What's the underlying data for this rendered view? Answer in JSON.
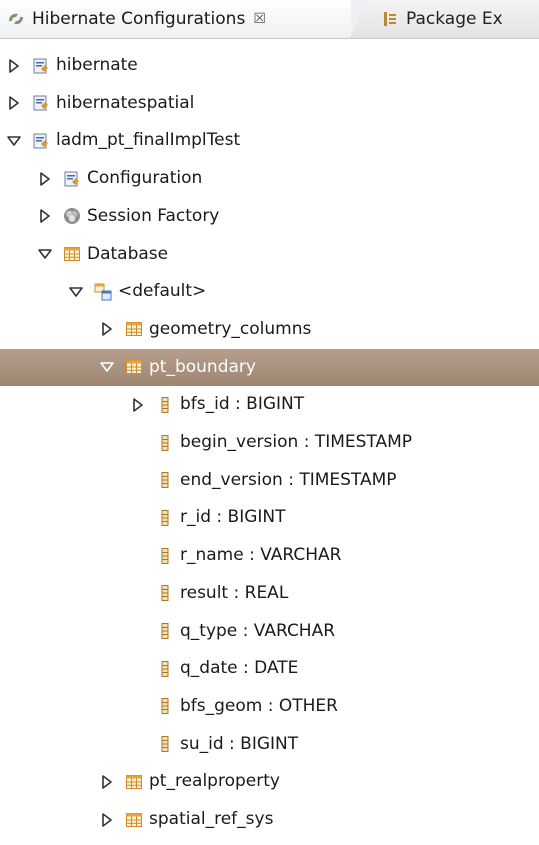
{
  "tabs": [
    {
      "label": "Hibernate Configurations",
      "close": "☒",
      "icon": "hibernate-config-icon",
      "active": true
    },
    {
      "label": "Package Ex",
      "icon": "package-explorer-icon",
      "active": false
    }
  ],
  "tree": {
    "rows": [
      {
        "label": "hibernate",
        "depth": 0,
        "twisty": "collapsed",
        "icon": "config-icon",
        "selected": false
      },
      {
        "label": "hibernatespatial",
        "depth": 0,
        "twisty": "collapsed",
        "icon": "config-icon",
        "selected": false
      },
      {
        "label": "ladm_pt_finalImplTest",
        "depth": 0,
        "twisty": "expanded",
        "icon": "config-icon",
        "selected": false
      },
      {
        "label": "Configuration",
        "depth": 1,
        "twisty": "collapsed",
        "icon": "config-icon",
        "selected": false
      },
      {
        "label": "Session Factory",
        "depth": 1,
        "twisty": "collapsed",
        "icon": "session-factory-icon",
        "selected": false
      },
      {
        "label": "Database",
        "depth": 1,
        "twisty": "expanded",
        "icon": "table-icon",
        "selected": false
      },
      {
        "label": "<default>",
        "depth": 2,
        "twisty": "expanded",
        "icon": "schema-icon",
        "selected": false
      },
      {
        "label": "geometry_columns",
        "depth": 3,
        "twisty": "collapsed",
        "icon": "table-icon",
        "selected": false
      },
      {
        "label": "pt_boundary",
        "depth": 3,
        "twisty": "expanded",
        "icon": "table-icon",
        "selected": true
      },
      {
        "label": "bfs_id : BIGINT",
        "depth": 4,
        "twisty": "collapsed",
        "icon": "column-icon",
        "selected": false
      },
      {
        "label": "begin_version : TIMESTAMP",
        "depth": 4,
        "twisty": "none",
        "icon": "column-icon",
        "selected": false
      },
      {
        "label": "end_version : TIMESTAMP",
        "depth": 4,
        "twisty": "none",
        "icon": "column-icon",
        "selected": false
      },
      {
        "label": "r_id : BIGINT",
        "depth": 4,
        "twisty": "none",
        "icon": "column-icon",
        "selected": false
      },
      {
        "label": "r_name : VARCHAR",
        "depth": 4,
        "twisty": "none",
        "icon": "column-icon",
        "selected": false
      },
      {
        "label": "result : REAL",
        "depth": 4,
        "twisty": "none",
        "icon": "column-icon",
        "selected": false
      },
      {
        "label": "q_type : VARCHAR",
        "depth": 4,
        "twisty": "none",
        "icon": "column-icon",
        "selected": false
      },
      {
        "label": "q_date : DATE",
        "depth": 4,
        "twisty": "none",
        "icon": "column-icon",
        "selected": false
      },
      {
        "label": "bfs_geom : OTHER",
        "depth": 4,
        "twisty": "none",
        "icon": "column-icon",
        "selected": false
      },
      {
        "label": "su_id : BIGINT",
        "depth": 4,
        "twisty": "none",
        "icon": "column-icon",
        "selected": false
      },
      {
        "label": "pt_realproperty",
        "depth": 3,
        "twisty": "collapsed",
        "icon": "table-icon",
        "selected": false
      },
      {
        "label": "spatial_ref_sys",
        "depth": 3,
        "twisty": "collapsed",
        "icon": "table-icon",
        "selected": false
      }
    ]
  },
  "colors": {
    "selection": "#a58d79",
    "selection_text": "#ffffff",
    "table_icon": "#e8a33c",
    "column_icon": "#c8932f"
  }
}
